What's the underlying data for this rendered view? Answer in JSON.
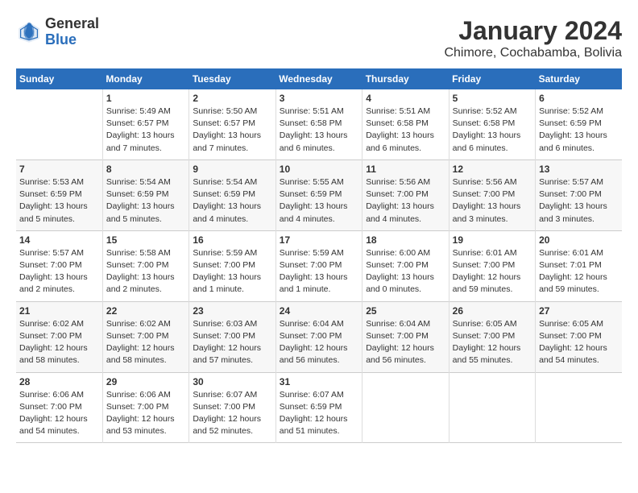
{
  "logo": {
    "general": "General",
    "blue": "Blue"
  },
  "title": "January 2024",
  "subtitle": "Chimore, Cochabamba, Bolivia",
  "days_header": [
    "Sunday",
    "Monday",
    "Tuesday",
    "Wednesday",
    "Thursday",
    "Friday",
    "Saturday"
  ],
  "weeks": [
    [
      {
        "num": "",
        "sunrise": "",
        "sunset": "",
        "daylight": ""
      },
      {
        "num": "1",
        "sunrise": "Sunrise: 5:49 AM",
        "sunset": "Sunset: 6:57 PM",
        "daylight": "Daylight: 13 hours and 7 minutes."
      },
      {
        "num": "2",
        "sunrise": "Sunrise: 5:50 AM",
        "sunset": "Sunset: 6:57 PM",
        "daylight": "Daylight: 13 hours and 7 minutes."
      },
      {
        "num": "3",
        "sunrise": "Sunrise: 5:51 AM",
        "sunset": "Sunset: 6:58 PM",
        "daylight": "Daylight: 13 hours and 6 minutes."
      },
      {
        "num": "4",
        "sunrise": "Sunrise: 5:51 AM",
        "sunset": "Sunset: 6:58 PM",
        "daylight": "Daylight: 13 hours and 6 minutes."
      },
      {
        "num": "5",
        "sunrise": "Sunrise: 5:52 AM",
        "sunset": "Sunset: 6:58 PM",
        "daylight": "Daylight: 13 hours and 6 minutes."
      },
      {
        "num": "6",
        "sunrise": "Sunrise: 5:52 AM",
        "sunset": "Sunset: 6:59 PM",
        "daylight": "Daylight: 13 hours and 6 minutes."
      }
    ],
    [
      {
        "num": "7",
        "sunrise": "Sunrise: 5:53 AM",
        "sunset": "Sunset: 6:59 PM",
        "daylight": "Daylight: 13 hours and 5 minutes."
      },
      {
        "num": "8",
        "sunrise": "Sunrise: 5:54 AM",
        "sunset": "Sunset: 6:59 PM",
        "daylight": "Daylight: 13 hours and 5 minutes."
      },
      {
        "num": "9",
        "sunrise": "Sunrise: 5:54 AM",
        "sunset": "Sunset: 6:59 PM",
        "daylight": "Daylight: 13 hours and 4 minutes."
      },
      {
        "num": "10",
        "sunrise": "Sunrise: 5:55 AM",
        "sunset": "Sunset: 6:59 PM",
        "daylight": "Daylight: 13 hours and 4 minutes."
      },
      {
        "num": "11",
        "sunrise": "Sunrise: 5:56 AM",
        "sunset": "Sunset: 7:00 PM",
        "daylight": "Daylight: 13 hours and 4 minutes."
      },
      {
        "num": "12",
        "sunrise": "Sunrise: 5:56 AM",
        "sunset": "Sunset: 7:00 PM",
        "daylight": "Daylight: 13 hours and 3 minutes."
      },
      {
        "num": "13",
        "sunrise": "Sunrise: 5:57 AM",
        "sunset": "Sunset: 7:00 PM",
        "daylight": "Daylight: 13 hours and 3 minutes."
      }
    ],
    [
      {
        "num": "14",
        "sunrise": "Sunrise: 5:57 AM",
        "sunset": "Sunset: 7:00 PM",
        "daylight": "Daylight: 13 hours and 2 minutes."
      },
      {
        "num": "15",
        "sunrise": "Sunrise: 5:58 AM",
        "sunset": "Sunset: 7:00 PM",
        "daylight": "Daylight: 13 hours and 2 minutes."
      },
      {
        "num": "16",
        "sunrise": "Sunrise: 5:59 AM",
        "sunset": "Sunset: 7:00 PM",
        "daylight": "Daylight: 13 hours and 1 minute."
      },
      {
        "num": "17",
        "sunrise": "Sunrise: 5:59 AM",
        "sunset": "Sunset: 7:00 PM",
        "daylight": "Daylight: 13 hours and 1 minute."
      },
      {
        "num": "18",
        "sunrise": "Sunrise: 6:00 AM",
        "sunset": "Sunset: 7:00 PM",
        "daylight": "Daylight: 13 hours and 0 minutes."
      },
      {
        "num": "19",
        "sunrise": "Sunrise: 6:01 AM",
        "sunset": "Sunset: 7:00 PM",
        "daylight": "Daylight: 12 hours and 59 minutes."
      },
      {
        "num": "20",
        "sunrise": "Sunrise: 6:01 AM",
        "sunset": "Sunset: 7:01 PM",
        "daylight": "Daylight: 12 hours and 59 minutes."
      }
    ],
    [
      {
        "num": "21",
        "sunrise": "Sunrise: 6:02 AM",
        "sunset": "Sunset: 7:00 PM",
        "daylight": "Daylight: 12 hours and 58 minutes."
      },
      {
        "num": "22",
        "sunrise": "Sunrise: 6:02 AM",
        "sunset": "Sunset: 7:00 PM",
        "daylight": "Daylight: 12 hours and 58 minutes."
      },
      {
        "num": "23",
        "sunrise": "Sunrise: 6:03 AM",
        "sunset": "Sunset: 7:00 PM",
        "daylight": "Daylight: 12 hours and 57 minutes."
      },
      {
        "num": "24",
        "sunrise": "Sunrise: 6:04 AM",
        "sunset": "Sunset: 7:00 PM",
        "daylight": "Daylight: 12 hours and 56 minutes."
      },
      {
        "num": "25",
        "sunrise": "Sunrise: 6:04 AM",
        "sunset": "Sunset: 7:00 PM",
        "daylight": "Daylight: 12 hours and 56 minutes."
      },
      {
        "num": "26",
        "sunrise": "Sunrise: 6:05 AM",
        "sunset": "Sunset: 7:00 PM",
        "daylight": "Daylight: 12 hours and 55 minutes."
      },
      {
        "num": "27",
        "sunrise": "Sunrise: 6:05 AM",
        "sunset": "Sunset: 7:00 PM",
        "daylight": "Daylight: 12 hours and 54 minutes."
      }
    ],
    [
      {
        "num": "28",
        "sunrise": "Sunrise: 6:06 AM",
        "sunset": "Sunset: 7:00 PM",
        "daylight": "Daylight: 12 hours and 54 minutes."
      },
      {
        "num": "29",
        "sunrise": "Sunrise: 6:06 AM",
        "sunset": "Sunset: 7:00 PM",
        "daylight": "Daylight: 12 hours and 53 minutes."
      },
      {
        "num": "30",
        "sunrise": "Sunrise: 6:07 AM",
        "sunset": "Sunset: 7:00 PM",
        "daylight": "Daylight: 12 hours and 52 minutes."
      },
      {
        "num": "31",
        "sunrise": "Sunrise: 6:07 AM",
        "sunset": "Sunset: 6:59 PM",
        "daylight": "Daylight: 12 hours and 51 minutes."
      },
      {
        "num": "",
        "sunrise": "",
        "sunset": "",
        "daylight": ""
      },
      {
        "num": "",
        "sunrise": "",
        "sunset": "",
        "daylight": ""
      },
      {
        "num": "",
        "sunrise": "",
        "sunset": "",
        "daylight": ""
      }
    ]
  ]
}
